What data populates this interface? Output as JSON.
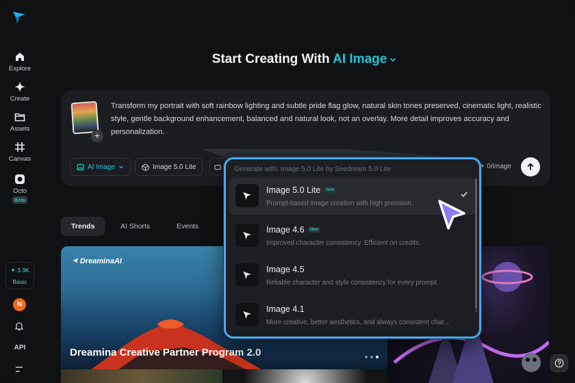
{
  "sidebar": {
    "items": [
      {
        "label": "Explore",
        "icon": "home-icon"
      },
      {
        "label": "Create",
        "icon": "sparkle-icon"
      },
      {
        "label": "Assets",
        "icon": "folder-icon"
      },
      {
        "label": "Canvas",
        "icon": "canvas-icon"
      },
      {
        "label": "Octo",
        "icon": "octo-icon",
        "badge": "Beta"
      }
    ],
    "credits": "3.3K",
    "plan": "Basic",
    "avatar_letter": "N",
    "api_label": "API"
  },
  "headline": {
    "prefix": "Start Creating With",
    "accent": "AI Image"
  },
  "prompt": {
    "text": "Transform my portrait with soft rainbow lighting and subtle pride flag glow, natural skin tones preserved, cinematic light, realistic style, gentle background enhancement, balanced and natural look, not an overlay. More detail improves accuracy and personalization.",
    "mode_chip": "AI Image",
    "model_chip": "Image 5.0 Lite",
    "cost": "0/image"
  },
  "tabs": [
    {
      "label": "Trends",
      "active": true
    },
    {
      "label": "AI Shorts",
      "active": false
    },
    {
      "label": "Events",
      "active": false
    }
  ],
  "banner": {
    "logo": "DreaminaAI",
    "title": "Dreamina Creative Partner Program 2.0"
  },
  "dropdown": {
    "header": "Generate with: Image 5.0 Lite by Seedream 5.0 Lite",
    "items": [
      {
        "name": "Image 5.0 Lite",
        "badge": "New",
        "desc": "Prompt-based image creation with high precision.",
        "selected": true
      },
      {
        "name": "Image 4.6",
        "badge": "New",
        "desc": "Improved character consistency. Efficient on credits.",
        "selected": false
      },
      {
        "name": "Image 4.5",
        "badge": "",
        "desc": "Reliable character and style consistency for every prompt.",
        "selected": false
      },
      {
        "name": "Image 4.1",
        "badge": "",
        "desc": "More creative, better aesthetics, and always consistent char...",
        "selected": false
      }
    ]
  },
  "colors": {
    "accent": "#25c3d6",
    "highlight_border": "#4aa8ee",
    "cursor": "#8b7cf6",
    "background": "#101113"
  }
}
